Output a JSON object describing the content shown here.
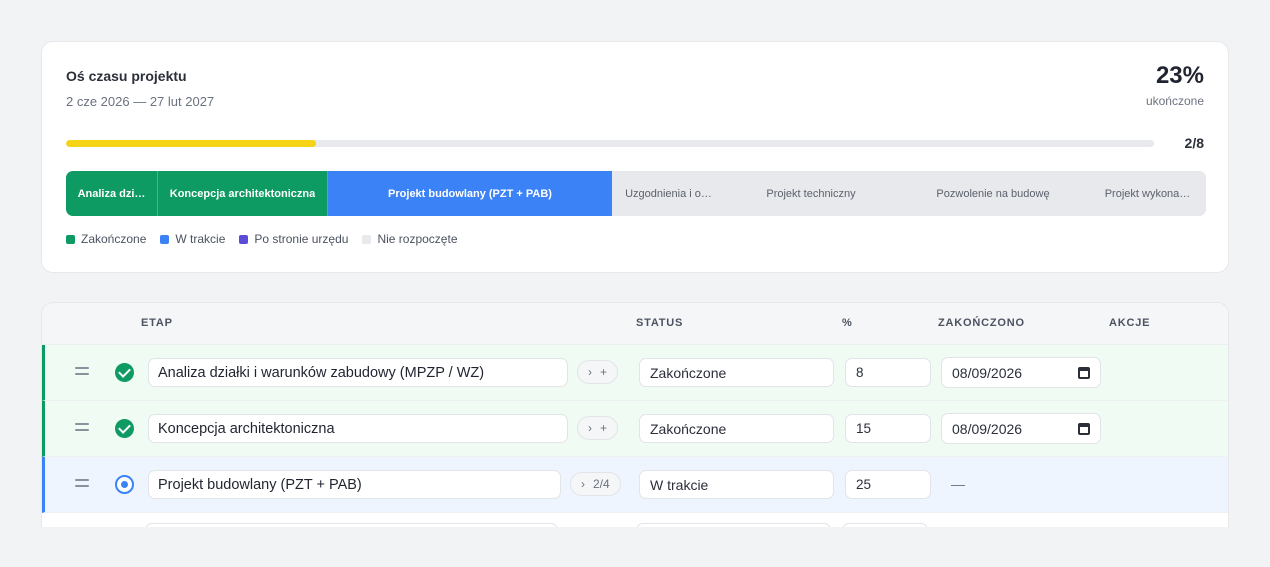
{
  "timeline": {
    "title": "Oś czasu projektu",
    "date_range": "2 cze 2026 — 27 lut 2027",
    "percent": "23%",
    "percent_label": "ukończone",
    "progress_fraction": 0.23,
    "count": "2/8",
    "colors": {
      "done": "#0e9a63",
      "active": "#3b82f6",
      "office": "#5b4bd6",
      "todo": "#e8e9ec",
      "progress": "#f5d416"
    },
    "segments": [
      {
        "label": "Analiza dzi…",
        "state": "done"
      },
      {
        "label": "Koncepcja architektoniczna",
        "state": "done"
      },
      {
        "label": "Projekt budowlany (PZT + PAB)",
        "state": "active"
      },
      {
        "label": "Uzgodnienia i o…",
        "state": "todo"
      },
      {
        "label": "Projekt techniczny",
        "state": "todo"
      },
      {
        "label": "Pozwolenie na budowę",
        "state": "todo"
      },
      {
        "label": "Projekt wykona…",
        "state": "todo"
      }
    ],
    "legend": [
      {
        "label": "Zakończone",
        "color": "#0e9a63"
      },
      {
        "label": "W trakcie",
        "color": "#3b82f6"
      },
      {
        "label": "Po stronie urzędu",
        "color": "#5b4bd6"
      },
      {
        "label": "Nie rozpoczęte",
        "color": "#e8e9ec"
      }
    ]
  },
  "table": {
    "headers": {
      "stage": "ETAP",
      "status": "STATUS",
      "percent": "%",
      "completed": "ZAKOŃCZONO",
      "actions": "AKCJE"
    },
    "rows": [
      {
        "name": "Analiza działki i warunków zabudowy (MPZP / WZ)",
        "substeps": "",
        "status": "Zakończone",
        "percent": "8",
        "completed": "08/09/2026",
        "state": "done"
      },
      {
        "name": "Koncepcja architektoniczna",
        "substeps": "",
        "status": "Zakończone",
        "percent": "15",
        "completed": "08/09/2026",
        "state": "done"
      },
      {
        "name": "Projekt budowlany (PZT + PAB)",
        "substeps": "2/4",
        "status": "W trakcie",
        "percent": "25",
        "completed": "—",
        "state": "active"
      }
    ]
  }
}
